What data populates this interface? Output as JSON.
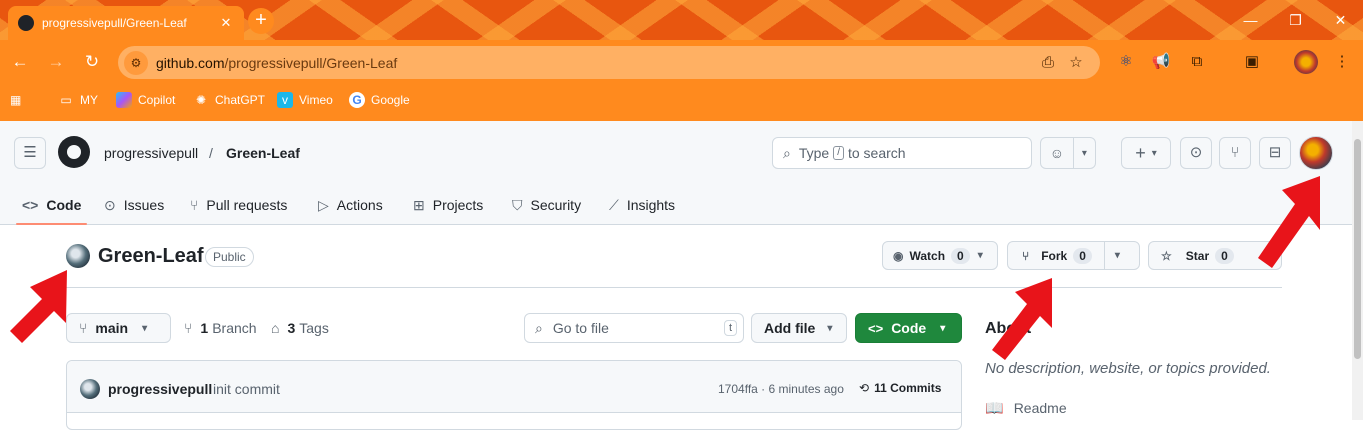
{
  "browser": {
    "tab_title": "progressivepull/Green-Leaf",
    "tab_close": "✕",
    "new_tab": "+",
    "url_host": "github.com",
    "url_path": "/progressivepull/Green-Leaf",
    "bookmarks": [
      {
        "label": "MY",
        "icon": "folder-icon"
      },
      {
        "label": "Copilot",
        "icon": "copilot-icon"
      },
      {
        "label": "ChatGPT",
        "icon": "chatgpt-icon"
      },
      {
        "label": "Vimeo",
        "icon": "vimeo-icon"
      },
      {
        "label": "Google",
        "icon": "google-icon"
      }
    ]
  },
  "header": {
    "owner": "progressivepull",
    "separator": "/",
    "repo": "Green-Leaf",
    "search_placeholder_pre": "Type",
    "search_key": "/",
    "search_placeholder_post": "to search"
  },
  "repo_nav": [
    {
      "label": "Code",
      "icon": "code-icon"
    },
    {
      "label": "Issues",
      "icon": "issue-icon"
    },
    {
      "label": "Pull requests",
      "icon": "pull-request-icon"
    },
    {
      "label": "Actions",
      "icon": "actions-icon"
    },
    {
      "label": "Projects",
      "icon": "projects-icon"
    },
    {
      "label": "Security",
      "icon": "shield-icon"
    },
    {
      "label": "Insights",
      "icon": "graph-icon"
    }
  ],
  "repo": {
    "name": "Green-Leaf",
    "visibility": "Public",
    "watch_label": "Watch",
    "watch_count": "0",
    "fork_label": "Fork",
    "fork_count": "0",
    "star_label": "Star",
    "star_count": "0"
  },
  "toolbar": {
    "branch": "main",
    "branch_count": "1",
    "branch_label": "Branch",
    "tag_count": "3",
    "tag_label": "Tags",
    "goto_placeholder": "Go to file",
    "goto_key": "t",
    "add_file": "Add file",
    "code": "Code"
  },
  "commit": {
    "author": "progressivepull",
    "message": "init commit",
    "hash_time": "1704ffa · 6 minutes ago",
    "commits": "11 Commits"
  },
  "about": {
    "title": "About",
    "description": "No description, website, or topics provided.",
    "readme": "Readme"
  },
  "colors": {
    "browser_accent": "#ff8a1e",
    "code_button": "#1f883d",
    "active_tab_underline": "#fd8c73",
    "annotation_arrow": "#e8141a"
  }
}
